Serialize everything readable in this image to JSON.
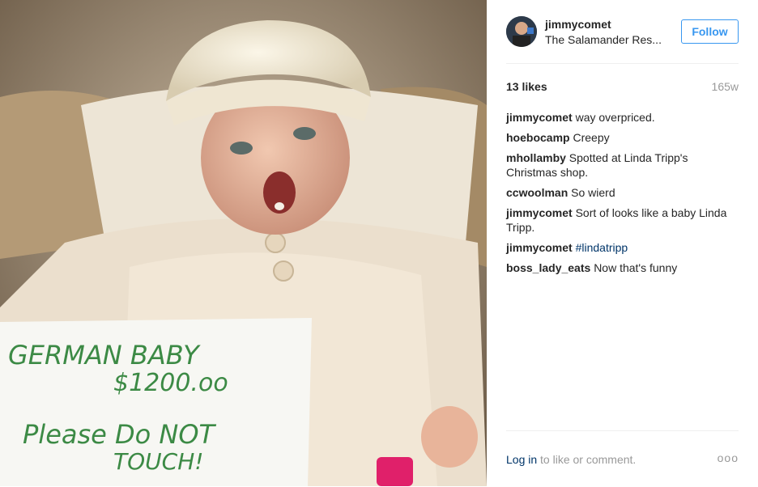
{
  "post": {
    "username": "jimmycomet",
    "location": "The Salamander Res...",
    "follow_label": "Follow",
    "likes": "13 likes",
    "age": "165w",
    "photo_sign": {
      "line1": "GERMAN BABY",
      "line2": "$1200.oo",
      "line3": "Please Do NOT",
      "line4": "TOUCH!"
    },
    "comments": [
      {
        "user": "jimmycomet",
        "text": "way overpriced."
      },
      {
        "user": "hoebocamp",
        "text": "Creepy"
      },
      {
        "user": "mhollamby",
        "text": "Spotted at Linda Tripp's Christmas shop."
      },
      {
        "user": "ccwoolman",
        "text": "So wierd"
      },
      {
        "user": "jimmycomet",
        "text": "Sort of looks like a baby Linda Tripp."
      },
      {
        "user": "jimmycomet",
        "hashtag": "#lindatripp"
      },
      {
        "user": "boss_lady_eats",
        "text": "Now that's funny"
      }
    ],
    "footer": {
      "login_label": "Log in",
      "login_suffix": " to like or comment.",
      "more_label": "ooo"
    }
  },
  "colors": {
    "accent": "#3897f0",
    "link": "#003569",
    "muted": "#999999",
    "text": "#262626"
  }
}
